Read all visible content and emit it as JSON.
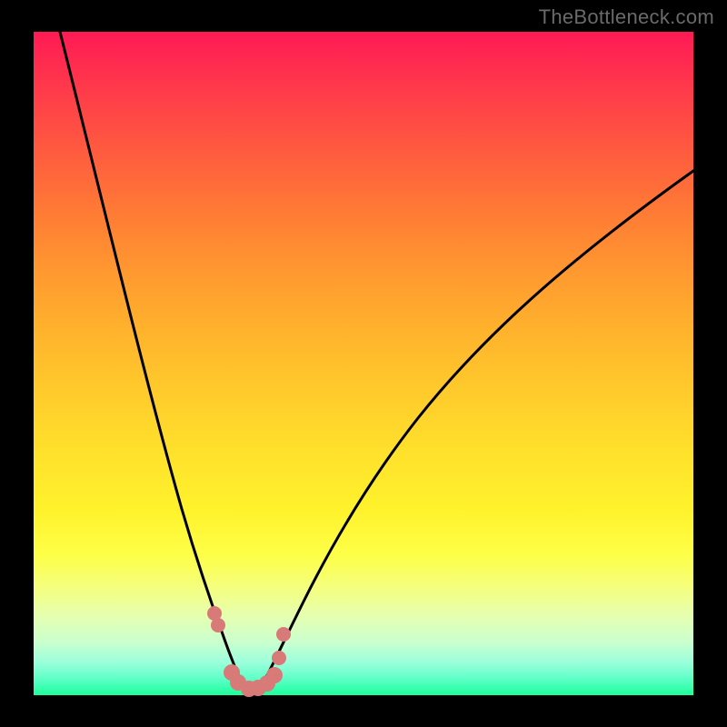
{
  "watermark": "TheBottleneck.com",
  "colors": {
    "frame": "#000000",
    "curve": "#000000",
    "marker": "#d87a78",
    "gradient_top": "#ff1a55",
    "gradient_bottom": "#1bff9a"
  },
  "chart_data": {
    "type": "line",
    "title": "",
    "xlabel": "",
    "ylabel": "",
    "xlim": [
      0,
      100
    ],
    "ylim": [
      0,
      100
    ],
    "series": [
      {
        "name": "left-curve",
        "x": [
          4,
          6,
          8,
          10,
          12,
          14,
          16,
          18,
          20,
          22,
          24,
          25,
          26,
          27,
          28,
          29,
          30,
          31
        ],
        "y": [
          100,
          93,
          86,
          79,
          72,
          65,
          58,
          51,
          43,
          35,
          25,
          19,
          14,
          10,
          6,
          3,
          1,
          0
        ]
      },
      {
        "name": "right-curve",
        "x": [
          31,
          32,
          33,
          34,
          36,
          38,
          42,
          46,
          50,
          56,
          62,
          70,
          78,
          86,
          94,
          100
        ],
        "y": [
          0,
          1,
          3,
          5,
          10,
          15,
          24,
          32,
          39,
          48,
          55,
          62,
          67,
          72,
          76,
          79
        ]
      },
      {
        "name": "markers",
        "x": [
          25.8,
          26.4,
          28.4,
          29.4,
          31.0,
          32.2,
          33.4,
          34.2,
          35.0,
          35.6
        ],
        "y": [
          13.0,
          11.0,
          3.5,
          2.0,
          1.0,
          1.2,
          2.0,
          3.2,
          6.0,
          9.5
        ]
      }
    ]
  }
}
